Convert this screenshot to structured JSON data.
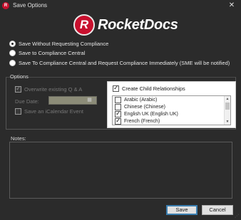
{
  "window": {
    "title": "Save Options",
    "app_icon_letter": "R"
  },
  "logo": {
    "mark": "R",
    "text": "RocketDocs"
  },
  "save_mode": {
    "options": [
      {
        "label": "Save Without Requesting Compliance",
        "selected": true
      },
      {
        "label": "Save to Compliance Central",
        "selected": false
      },
      {
        "label": "Save To Compliance Central and Request Compliance Immediately (SME will be notified)",
        "selected": false
      }
    ]
  },
  "options_group": {
    "label": "Options",
    "overwrite_label": "Overwrite existing Q & A",
    "due_date_label": "Due Date:",
    "due_date_value": "",
    "icalendar_label": "Save an iCalendar Event"
  },
  "child_relationships": {
    "label": "Create Child Relationships",
    "checked": true,
    "languages": [
      {
        "label": "Arabic (Arabic)",
        "checked": false
      },
      {
        "label": "Chinese (Chinese)",
        "checked": false
      },
      {
        "label": "English UK (English UK)",
        "checked": true
      },
      {
        "label": "French (French)",
        "checked": true
      }
    ]
  },
  "notes": {
    "label": "Notes:",
    "value": ""
  },
  "buttons": {
    "save": "Save",
    "cancel": "Cancel"
  },
  "colors": {
    "accent_red": "#c8102e",
    "dialog_bg": "#2b2b2b",
    "focus_blue": "#3c7fb1"
  }
}
